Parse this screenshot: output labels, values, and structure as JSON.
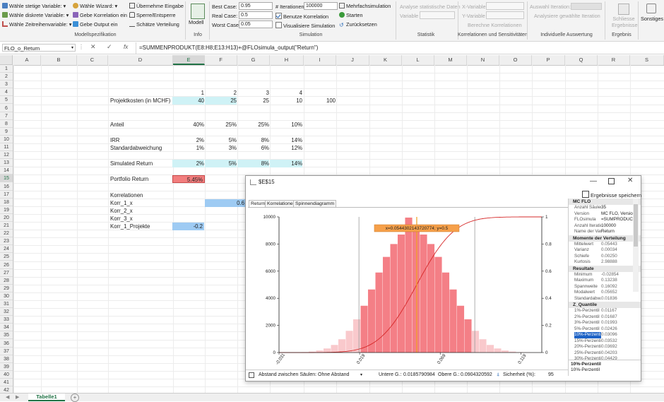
{
  "ribbon": {
    "col1": [
      "Wähle stetige Variable:",
      "Wähle diskrete Variable:",
      "Wähle Zeitreihenvariable:"
    ],
    "col2": [
      "Wähle Wizard:",
      "Gebe Korrelation ein",
      "Gebe Output ein"
    ],
    "col3": [
      "Übernehme Eingabe",
      "Sperre/Entsperre",
      "Schätze Verteilung"
    ],
    "group_modell": "Modellspezifikation",
    "modell_btn": "Modell",
    "group_info": "Info",
    "best_case_label": "Best Case:",
    "best_case_value": "0.95",
    "real_case_label": "Real Case:",
    "real_case_value": "0.5",
    "worst_case_label": "Worst Case:",
    "worst_case_value": "0.05",
    "iter_label": "# Iterationen:",
    "iter_value": "100000",
    "benutze_korrelation": "Benutze Korrelation",
    "visualisiere": "Visualisiere Simulation",
    "mehrfach": "Mehrfachsimulation",
    "starten": "Starten",
    "zuruecksetzen": "Zurücksetzen",
    "group_simulation": "Simulation",
    "analyse": "Analyse statistische Daten",
    "variable": "Variable",
    "group_statistik": "Statistik",
    "x_variable": "X-Variable",
    "y_variable": "Y-Variable",
    "berechne_korr": "Berechne Korrelationen",
    "group_korr": "Korrelationen und Sensitivitäten",
    "auswahl_iter": "Auswahl Iteration:",
    "analysiere": "Analysiere gewählte Iteration",
    "group_indiv": "Individuelle Auswertung",
    "schliesse": "Schliesse Ergebnisse",
    "group_ergebnis": "Ergebnis",
    "sonstiges": "Sonstiges"
  },
  "formula": {
    "name_box": "FLO_o_Return",
    "fx": "fx",
    "content": "=SUMMENPRODUKT(E8:H8;E13:H13)+@FLOsimula_output(\"Return\")"
  },
  "columns": [
    "A",
    "B",
    "C",
    "D",
    "E",
    "F",
    "G",
    "H",
    "I",
    "J",
    "K",
    "L",
    "M",
    "N",
    "O",
    "P",
    "Q",
    "R",
    "S"
  ],
  "rows": [
    "1",
    "2",
    "3",
    "4",
    "5",
    "6",
    "7",
    "8",
    "9",
    "10",
    "11",
    "12",
    "13",
    "14",
    "15",
    "16",
    "17",
    "18",
    "19",
    "20",
    "21",
    "22",
    "23",
    "24",
    "25",
    "26",
    "27",
    "28",
    "29",
    "30",
    "31",
    "32",
    "33",
    "34",
    "35",
    "36",
    "37",
    "38",
    "39",
    "40",
    "41",
    "42"
  ],
  "sheet": {
    "header_nums": [
      "1",
      "2",
      "3",
      "4"
    ],
    "projektkosten_label": "Projektkosten (in MCHF)",
    "projektkosten": [
      "40",
      "25",
      "25",
      "10"
    ],
    "projektkosten_total": "100",
    "anteil_label": "Anteil",
    "anteil": [
      "40%",
      "25%",
      "25%",
      "10%"
    ],
    "irr_label": "IRR",
    "irr": [
      "2%",
      "5%",
      "8%",
      "14%"
    ],
    "std_label": "Standardabweichung",
    "std": [
      "1%",
      "3%",
      "6%",
      "12%"
    ],
    "sim_label": "Simulated Return",
    "sim": [
      "2%",
      "5%",
      "8%",
      "14%"
    ],
    "portfolio_label": "Portfolio Return",
    "portfolio_value": "5.45%",
    "korr_label": "Korrelationen",
    "korr1_label": "Korr_1_x",
    "korr1_value": "0.6",
    "korr2_label": "Korr_2_x",
    "korr3_label": "Korr_3_x",
    "korrp_label": "Korr_1_Projekte",
    "korrp_value": "-0.2"
  },
  "tabs": {
    "sheet1": "Tabelle1"
  },
  "popup": {
    "title": "$E$15",
    "save_label": "Ergebnisse speichern",
    "tabs": [
      "Return",
      "Korrelationen",
      "Spinnendiagramm"
    ],
    "tooltip": "x=0.0544302143720774; y=0.5",
    "bottom": {
      "spacing_label": "Abstand zwischen Säulen:",
      "spacing_value": "Ohne Abstand",
      "lower_label": "Untere G.:",
      "lower_value": "0.0185790984",
      "upper_label": "Obere G.:",
      "upper_value": "0.0904320592",
      "conf_label": "Sicherheit (%):",
      "conf_value": "95"
    },
    "props": {
      "section_mc": "MC FLO",
      "mc": [
        {
          "k": "Anzahl Säulen",
          "v": "35"
        },
        {
          "k": "Version",
          "v": "MC FLO, Version"
        },
        {
          "k": "FLOsimula",
          "v": "=SUMPRODUCT"
        },
        {
          "k": "Anzahl Iterationen",
          "v": "100000"
        },
        {
          "k": "Name der Variable",
          "v": "Return"
        }
      ],
      "section_momente": "Momente der Verteilung",
      "momente": [
        {
          "k": "Mittelwert",
          "v": "0.05443"
        },
        {
          "k": "Varianz",
          "v": "0.00034"
        },
        {
          "k": "Schiefe",
          "v": "0.00250"
        },
        {
          "k": "Kurtosis",
          "v": "2.98888"
        }
      ],
      "section_resultate": "Resultate",
      "resultate": [
        {
          "k": "Minimum",
          "v": "-0.02854"
        },
        {
          "k": "Maximum",
          "v": "0.13238"
        },
        {
          "k": "Spannweite",
          "v": "0.16092"
        },
        {
          "k": "Modalwert",
          "v": "0.05652"
        },
        {
          "k": "Standardabw.",
          "v": "0.01836"
        }
      ],
      "section_quantile": "Z_Quantile",
      "quantile": [
        {
          "k": "1%-Perzentil",
          "v": "0.01167"
        },
        {
          "k": "2%-Perzentil",
          "v": "0.01687"
        },
        {
          "k": "3%-Perzentil",
          "v": "0.01993"
        },
        {
          "k": "5%-Perzentil",
          "v": "0.02426"
        },
        {
          "k": "10%-Perzentil",
          "v": "0.03096"
        },
        {
          "k": "15%-Perzentil",
          "v": "0.03532"
        },
        {
          "k": "20%-Perzentil",
          "v": "0.03692"
        },
        {
          "k": "25%-Perzentil",
          "v": "0.04203"
        },
        {
          "k": "30%-Perzentil",
          "v": "0.04429"
        }
      ],
      "desc_title": "10%-Perzentil",
      "desc_text": "10%-Perzentil"
    }
  },
  "chart_data": {
    "type": "bar",
    "title": "",
    "xlabel": "",
    "ylabel": "",
    "x_ticks": [
      "-0.031",
      "0.019",
      "0.069",
      "0.119"
    ],
    "y_ticks": [
      "0",
      "2000",
      "4000",
      "6000",
      "8000",
      "10000"
    ],
    "y2_ticks": [
      "0",
      "0.2",
      "0.4",
      "0.6",
      "0.8",
      "1"
    ],
    "xlim": [
      -0.031,
      0.132
    ],
    "ylim": [
      0,
      10000
    ],
    "y2lim": [
      0,
      1
    ],
    "mean": 0.05443,
    "std": 0.01836,
    "bin_width": 0.0046,
    "lower_bound": 0.0185790984,
    "upper_bound": 0.0904320592,
    "marker_x": 0.05443,
    "bins_x": [
      -0.0287,
      -0.0241,
      -0.0195,
      -0.0149,
      -0.0103,
      -0.0057,
      -0.0011,
      0.0035,
      0.0081,
      0.0127,
      0.0173,
      0.0219,
      0.0265,
      0.0311,
      0.0357,
      0.0403,
      0.0449,
      0.0495,
      0.0541,
      0.0587,
      0.0633,
      0.0679,
      0.0725,
      0.0771,
      0.0817,
      0.0863,
      0.0909,
      0.0955,
      0.1001,
      0.1047,
      0.1093,
      0.1139,
      0.1185,
      0.1231,
      0.1277
    ],
    "counts": [
      2,
      5,
      12,
      30,
      70,
      150,
      300,
      560,
      980,
      1600,
      2450,
      3450,
      4650,
      5900,
      7050,
      8000,
      8700,
      9950,
      9200,
      8700,
      8000,
      7050,
      5900,
      4650,
      3450,
      2450,
      1600,
      980,
      560,
      300,
      150,
      70,
      30,
      12,
      5
    ]
  }
}
